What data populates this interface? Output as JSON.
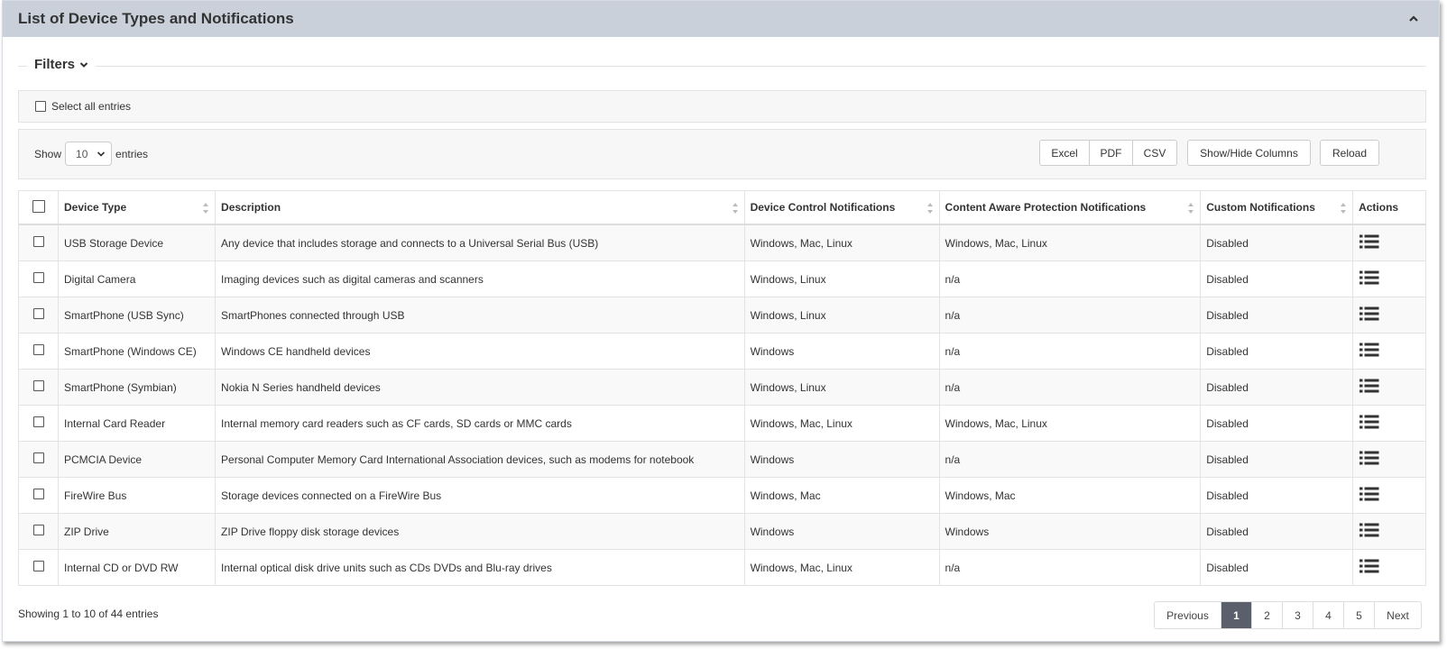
{
  "panel": {
    "title": "List of Device Types and Notifications"
  },
  "filters": {
    "label": "Filters"
  },
  "select_all": {
    "label": "Select all entries"
  },
  "toolbar": {
    "show_label": "Show",
    "entries_value": "10",
    "entries_label": "entries",
    "excel_label": "Excel",
    "pdf_label": "PDF",
    "csv_label": "CSV",
    "show_hide_label": "Show/Hide Columns",
    "reload_label": "Reload"
  },
  "table": {
    "headers": {
      "device_type": "Device Type",
      "description": "Description",
      "device_control": "Device Control Notifications",
      "content_aware": "Content Aware Protection Notifications",
      "custom": "Custom Notifications",
      "actions": "Actions"
    },
    "rows": [
      {
        "device_type": "USB Storage Device",
        "description": "Any device that includes storage and connects to a Universal Serial Bus (USB)",
        "device_control": "Windows, Mac, Linux",
        "content_aware": "Windows, Mac, Linux",
        "custom": "Disabled"
      },
      {
        "device_type": "Digital Camera",
        "description": "Imaging devices such as digital cameras and scanners",
        "device_control": "Windows, Linux",
        "content_aware": "n/a",
        "custom": "Disabled"
      },
      {
        "device_type": "SmartPhone (USB Sync)",
        "description": "SmartPhones connected through USB",
        "device_control": "Windows, Linux",
        "content_aware": "n/a",
        "custom": "Disabled"
      },
      {
        "device_type": "SmartPhone (Windows CE)",
        "description": "Windows CE handheld devices",
        "device_control": "Windows",
        "content_aware": "n/a",
        "custom": "Disabled"
      },
      {
        "device_type": "SmartPhone (Symbian)",
        "description": "Nokia N Series handheld devices",
        "device_control": "Windows, Linux",
        "content_aware": "n/a",
        "custom": "Disabled"
      },
      {
        "device_type": "Internal Card Reader",
        "description": "Internal memory card readers such as CF cards, SD cards or MMC cards",
        "device_control": "Windows, Mac, Linux",
        "content_aware": "Windows, Mac, Linux",
        "custom": "Disabled"
      },
      {
        "device_type": "PCMCIA Device",
        "description": "Personal Computer Memory Card International Association devices, such as modems for notebook",
        "device_control": "Windows",
        "content_aware": "n/a",
        "custom": "Disabled"
      },
      {
        "device_type": "FireWire Bus",
        "description": "Storage devices connected on a FireWire Bus",
        "device_control": "Windows, Mac",
        "content_aware": "Windows, Mac",
        "custom": "Disabled"
      },
      {
        "device_type": "ZIP Drive",
        "description": "ZIP Drive floppy disk storage devices",
        "device_control": "Windows",
        "content_aware": "Windows",
        "custom": "Disabled"
      },
      {
        "device_type": "Internal CD or DVD RW",
        "description": "Internal optical disk drive units such as CDs DVDs and Blu-ray drives",
        "device_control": "Windows, Mac, Linux",
        "content_aware": "n/a",
        "custom": "Disabled"
      }
    ]
  },
  "footer": {
    "info": "Showing 1 to 10 of 44 entries",
    "previous": "Previous",
    "pages": [
      "1",
      "2",
      "3",
      "4",
      "5"
    ],
    "next": "Next",
    "active_page": "1"
  },
  "icons": {
    "collapse": "chevron-up-icon",
    "filters": "chevron-down-icon",
    "sort": "sort-icon",
    "actions": "list-icon"
  }
}
